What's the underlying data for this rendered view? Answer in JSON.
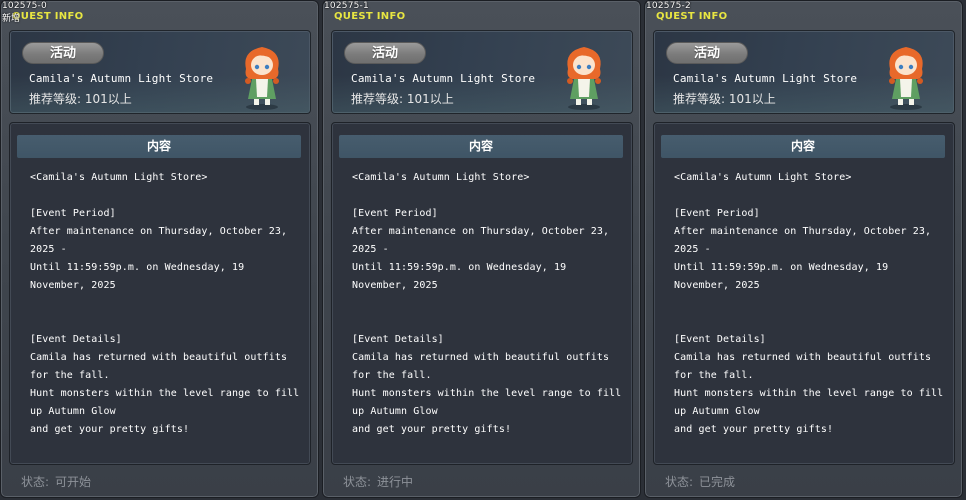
{
  "panels": [
    {
      "id": "102575-0",
      "sub": "新增",
      "title": "QUEST INFO",
      "type_label": "活动",
      "quest_name": "Camila's Autumn Light Store",
      "level": "推荐等级: 101以上",
      "content_header": "内容",
      "lines": [
        "<Camila's Autumn Light Store>",
        "",
        "[Event Period]",
        "After maintenance on Thursday, October 23,",
        "2025 -",
        "Until 11:59:59p.m. on Wednesday, 19",
        "November, 2025",
        "",
        "",
        "[Event Details]",
        "Camila has returned with beautiful outfits",
        "for the fall.",
        "Hunt monsters within the level range to fill",
        "up Autumn Glow",
        "and get your pretty gifts!"
      ],
      "status_label": "状态:",
      "status_value": "可开始"
    },
    {
      "id": "102575-1",
      "sub": "",
      "title": "QUEST INFO",
      "type_label": "活动",
      "quest_name": "Camila's Autumn Light Store",
      "level": "推荐等级: 101以上",
      "content_header": "内容",
      "lines": [
        "<Camila's Autumn Light Store>",
        "",
        "[Event Period]",
        "After maintenance on Thursday, October 23,",
        "2025 -",
        "Until 11:59:59p.m. on Wednesday, 19",
        "November, 2025",
        "",
        "",
        "[Event Details]",
        "Camila has returned with beautiful outfits",
        "for the fall.",
        "Hunt monsters within the level range to fill",
        "up Autumn Glow",
        "and get your pretty gifts!"
      ],
      "status_label": "状态:",
      "status_value": "进行中"
    },
    {
      "id": "102575-2",
      "sub": "",
      "title": "QUEST INFO",
      "type_label": "活动",
      "quest_name": "Camila's Autumn Light Store",
      "level": "推荐等级: 101以上",
      "content_header": "内容",
      "lines": [
        "<Camila's Autumn Light Store>",
        "",
        "[Event Period]",
        "After maintenance on Thursday, October 23,",
        "2025 -",
        "Until 11:59:59p.m. on Wednesday, 19",
        "November, 2025",
        "",
        "",
        "[Event Details]",
        "Camila has returned with beautiful outfits",
        "for the fall.",
        "Hunt monsters within the level range to fill",
        "up Autumn Glow",
        "and get your pretty gifts!"
      ],
      "status_label": "状态:",
      "status_value": "已完成"
    }
  ],
  "colors": {
    "title": "#e8e642",
    "status_text": "#8d9299",
    "hair": "#e8692a",
    "dress": "#5f9f62"
  }
}
